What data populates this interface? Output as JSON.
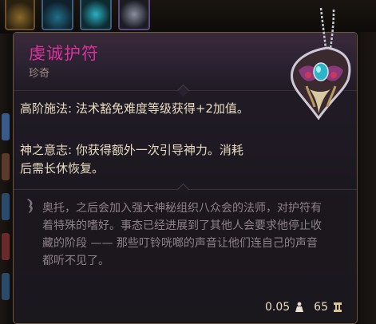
{
  "tooltip": {
    "title": "虔诚护符",
    "rarity": "珍奇",
    "properties": [
      {
        "text": "高阶施法: 法术豁免难度等级获得+2加值。"
      },
      {
        "text": "神之意志: 你获得额外一次引导神力。消耗后需长休恢复。"
      }
    ],
    "lore": "奥托，之后会加入强大神秘组织八众会的法师，对护符有着特殊的嗜好。事态已经进展到了其他人会要求他停止收藏的阶段 —— 那些叮铃咣啷的声音让他们连自己的声音都听不见了。",
    "weight": "0.05",
    "value": "65"
  },
  "icons": {
    "weight": "weight-icon",
    "gold": "gold-coin-icon",
    "lore": "quill-icon",
    "item": "amulet-icon"
  },
  "colors": {
    "title": "#d9329e",
    "text": "#e8dcc0",
    "lore": "#8d8389",
    "border": "#6f5a3a"
  }
}
